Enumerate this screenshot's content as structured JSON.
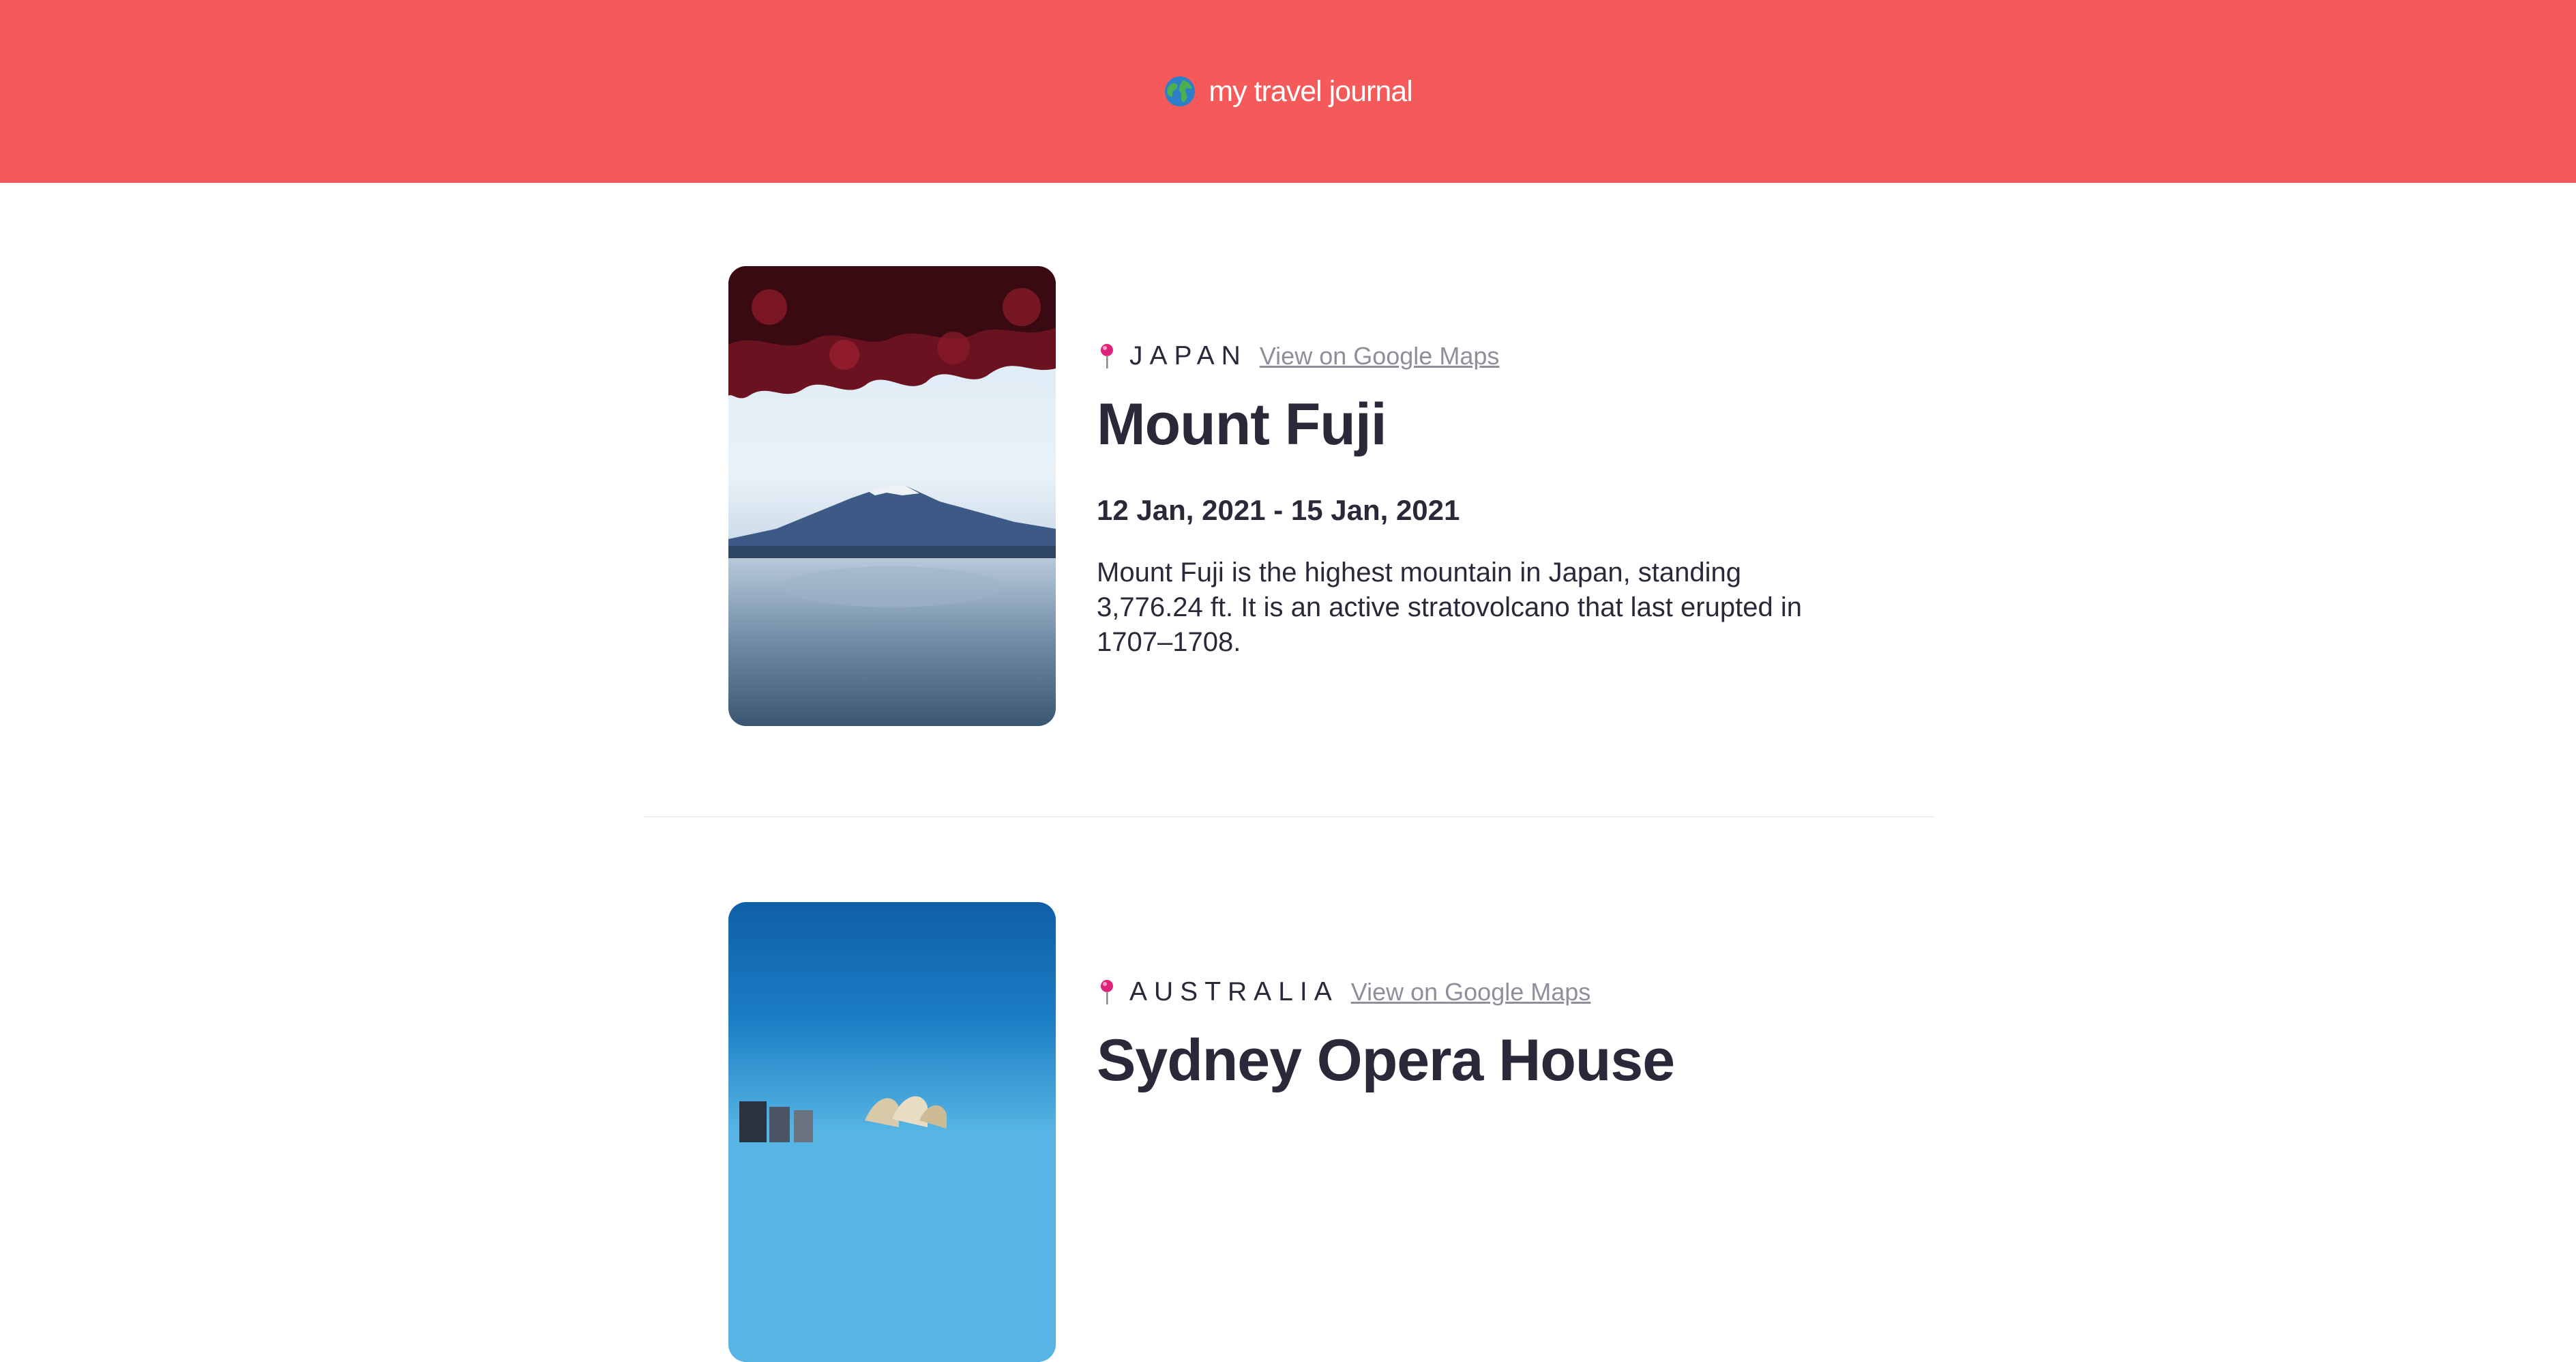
{
  "header": {
    "title": "my travel journal",
    "globe_icon": "globe-icon",
    "background_color": "#F55A5A"
  },
  "entries": [
    {
      "country": "JAPAN",
      "maps_link": "View on Google Maps",
      "title": "Mount Fuji",
      "dates": "12 Jan, 2021 - 15 Jan, 2021",
      "description": "Mount Fuji is the highest mountain in Japan, standing 3,776.24 ft. It is an active stratovolcano that last erupted in 1707–1708.",
      "pin_icon": "pin-icon",
      "photo": "mount-fuji-photo"
    },
    {
      "country": "AUSTRALIA",
      "maps_link": "View on Google Maps",
      "title": "Sydney Opera House",
      "pin_icon": "pin-icon",
      "photo": "sydney-opera-house-photo"
    }
  ]
}
